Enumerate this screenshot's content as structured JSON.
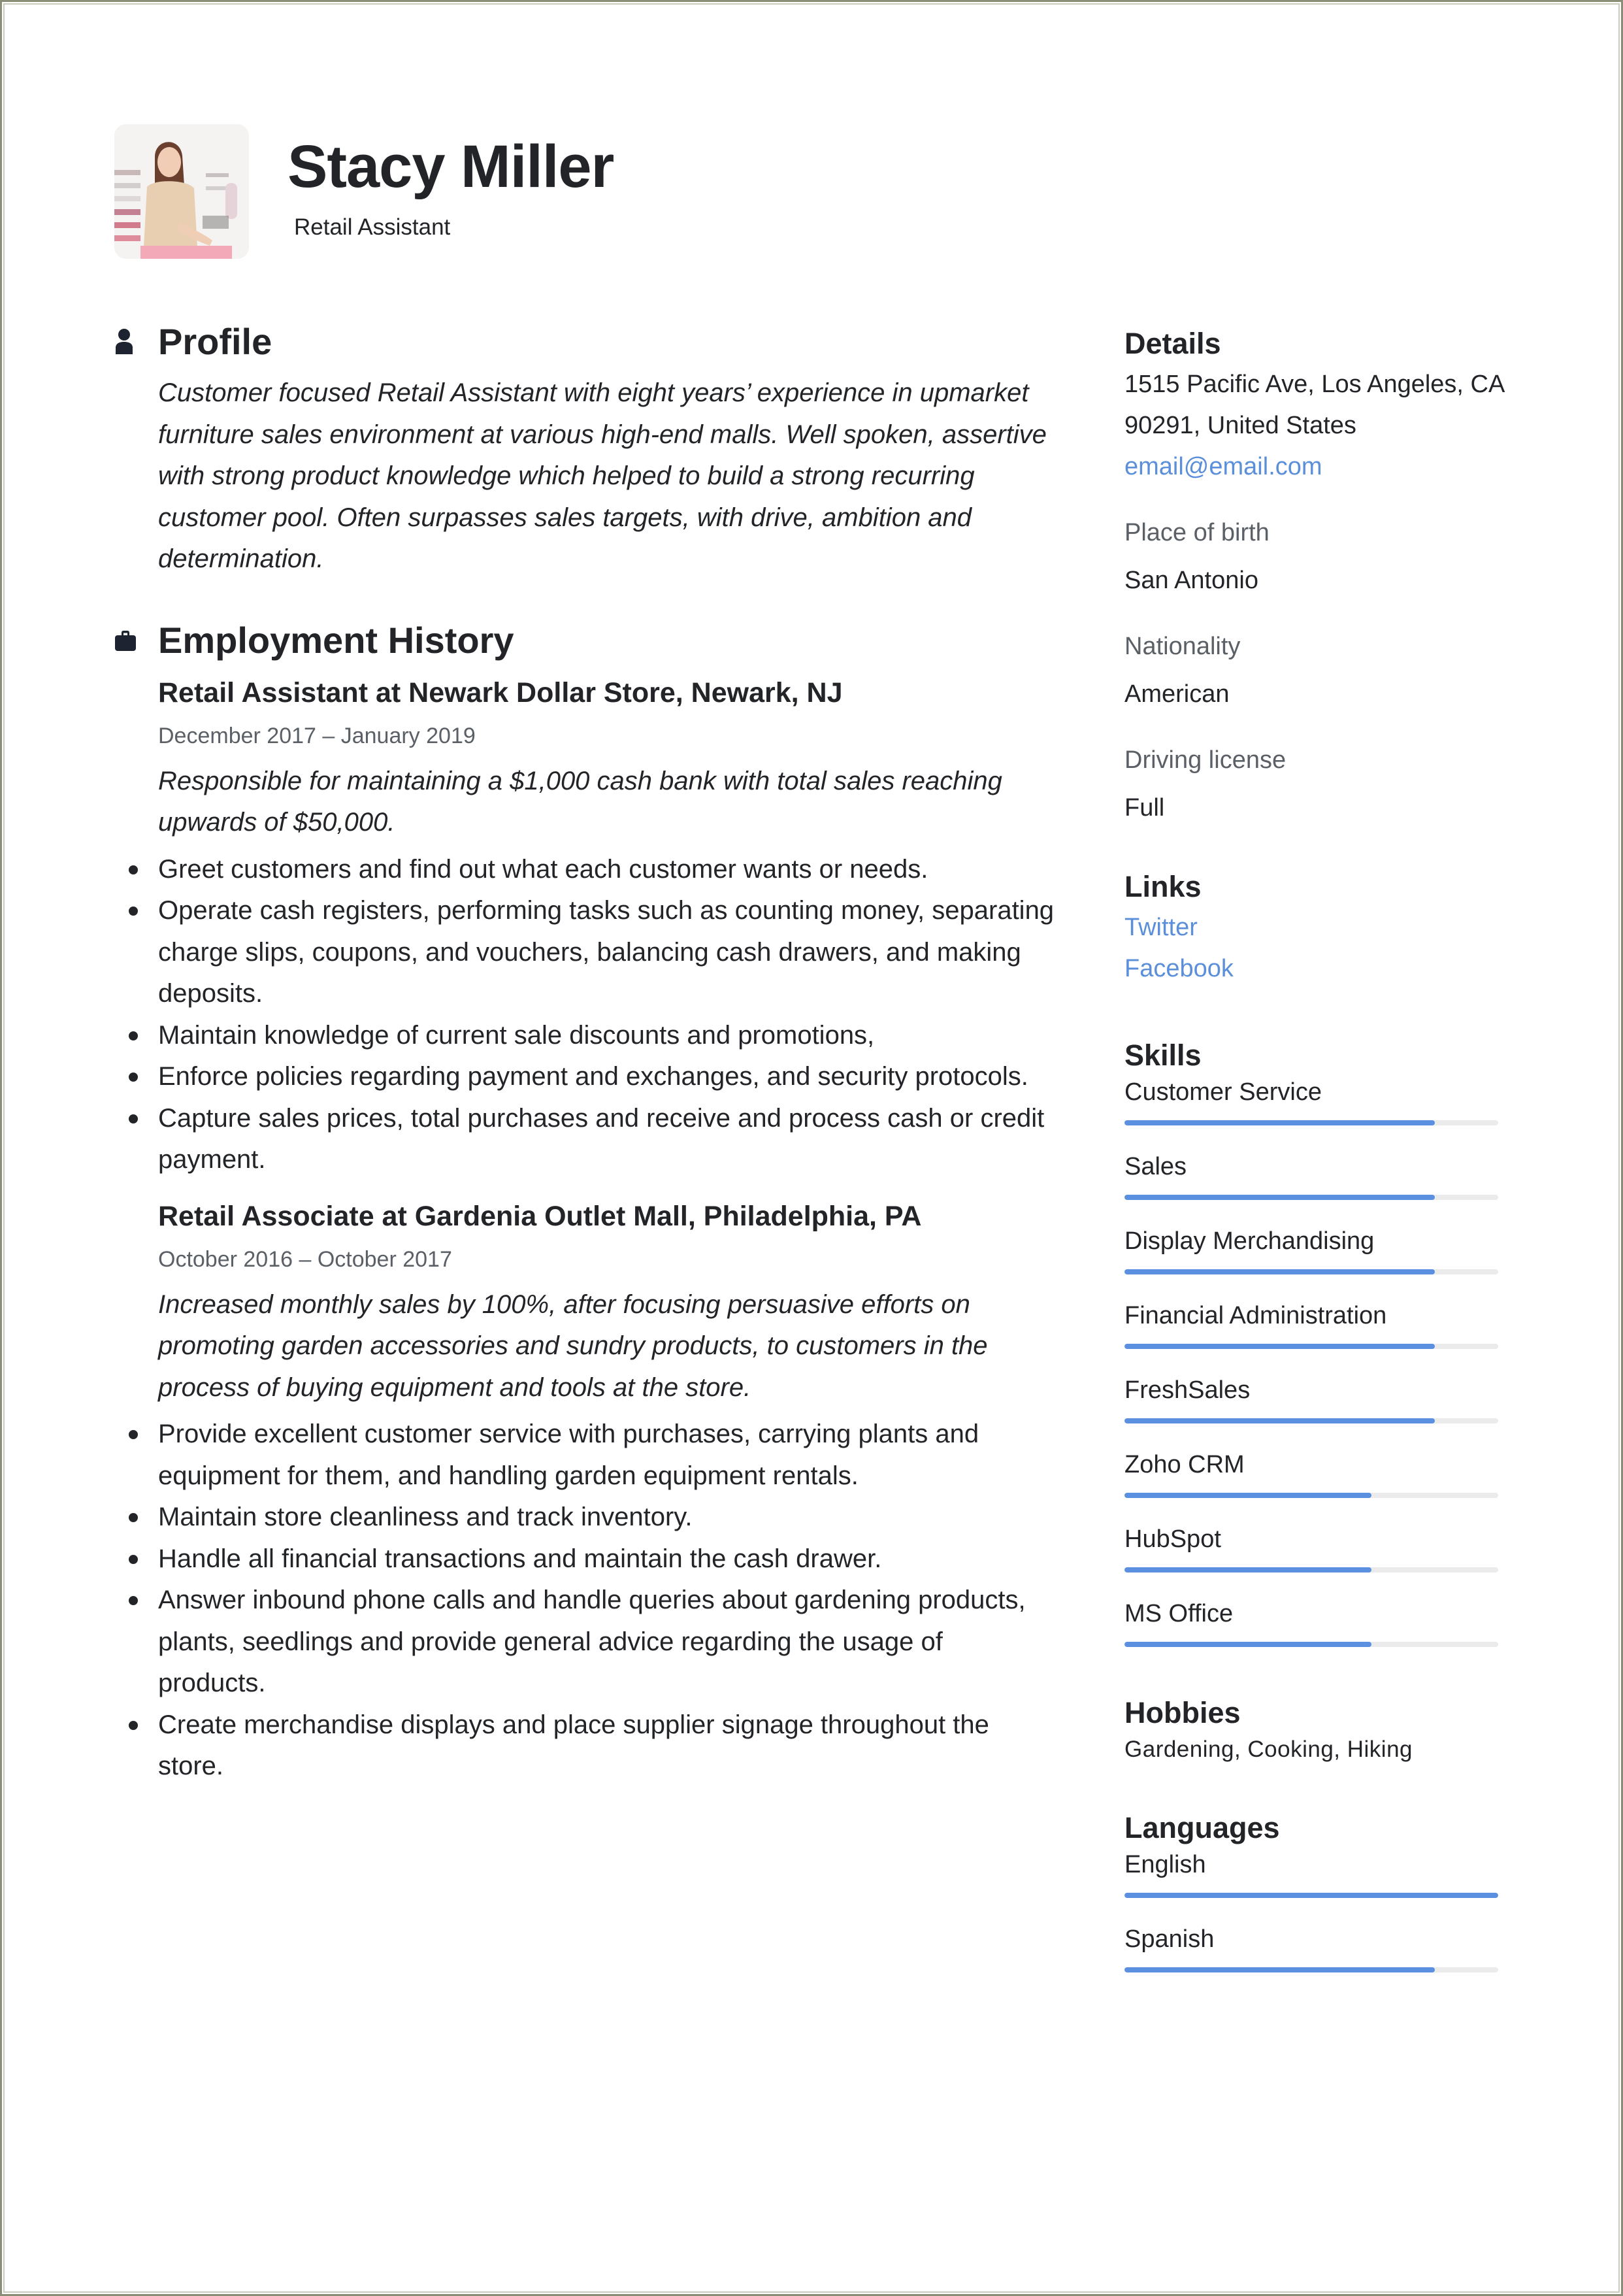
{
  "header": {
    "name": "Stacy Miller",
    "job_title": "Retail Assistant",
    "photo_alt": "profile-photo"
  },
  "profile": {
    "icon": "person-icon",
    "title": "Profile",
    "text": "Customer focused Retail Assistant with eight years’ experience in upmarket furniture sales environment at various high-end malls. Well spoken, assertive with strong product knowledge which helped to build a strong recurring customer pool. Often surpasses sales targets, with drive, ambition and determination."
  },
  "employment": {
    "icon": "briefcase-icon",
    "title": "Employment History",
    "jobs": [
      {
        "heading": "Retail Assistant at Newark Dollar Store, Newark, NJ",
        "dates": "December 2017  –  January 2019",
        "summary": "Responsible for maintaining a $1,000 cash bank with total sales reaching upwards of $50,000.",
        "bullets": [
          "Greet customers and find out what each customer wants or needs.",
          "Operate cash registers, performing tasks such as counting money, separating charge slips, coupons, and vouchers, balancing cash drawers, and making deposits.",
          "Maintain knowledge of current sale discounts and promotions,",
          "Enforce policies regarding payment and exchanges, and security protocols.",
          "Capture sales prices, total purchases and receive and process cash or credit payment."
        ]
      },
      {
        "heading": "Retail Associate at Gardenia Outlet Mall, Philadelphia, PA",
        "dates": "October 2016  –  October 2017",
        "summary": "Increased monthly sales by 100%, after focusing persuasive efforts on promoting garden accessories and sundry products, to customers in the process of buying equipment and tools at the store.",
        "bullets": [
          "Provide excellent customer service with purchases, carrying plants and equipment for them, and handling garden equipment rentals.",
          "Maintain store cleanliness and track inventory.",
          "Handle all financial transactions and maintain the cash drawer.",
          "Answer inbound phone calls and handle queries about gardening products, plants, seedlings and provide general advice regarding the usage of products.",
          "Create merchandise displays and place supplier signage throughout the store."
        ]
      }
    ]
  },
  "details": {
    "title": "Details",
    "address_line1": "1515 Pacific Ave, Los Angeles, CA",
    "address_line2": "90291, United States",
    "email": "email@email.com",
    "place_of_birth_label": "Place of birth",
    "place_of_birth": "San Antonio",
    "nationality_label": "Nationality",
    "nationality": "American",
    "driving_license_label": "Driving license",
    "driving_license": "Full"
  },
  "links": {
    "title": "Links",
    "items": [
      "Twitter",
      "Facebook"
    ]
  },
  "skills": {
    "title": "Skills",
    "items": [
      {
        "name": "Customer Service",
        "level": 0.83
      },
      {
        "name": "Sales",
        "level": 0.83
      },
      {
        "name": "Display Merchandising",
        "level": 0.83
      },
      {
        "name": "Financial Administration",
        "level": 0.83
      },
      {
        "name": "FreshSales",
        "level": 0.83
      },
      {
        "name": "Zoho CRM",
        "level": 0.66
      },
      {
        "name": "HubSpot",
        "level": 0.66
      },
      {
        "name": "MS Office",
        "level": 0.66
      }
    ]
  },
  "hobbies": {
    "title": "Hobbies",
    "text": "Gardening, Cooking, Hiking"
  },
  "languages": {
    "title": "Languages",
    "items": [
      {
        "name": "English",
        "level": 1.0
      },
      {
        "name": "Spanish",
        "level": 0.83
      }
    ]
  },
  "colors": {
    "accent": "#5b8fe0",
    "link": "#5b8fd9",
    "text": "#222428",
    "muted": "#5b6067",
    "bar_track": "#ecebeb",
    "page_border": "#8b8e76"
  }
}
